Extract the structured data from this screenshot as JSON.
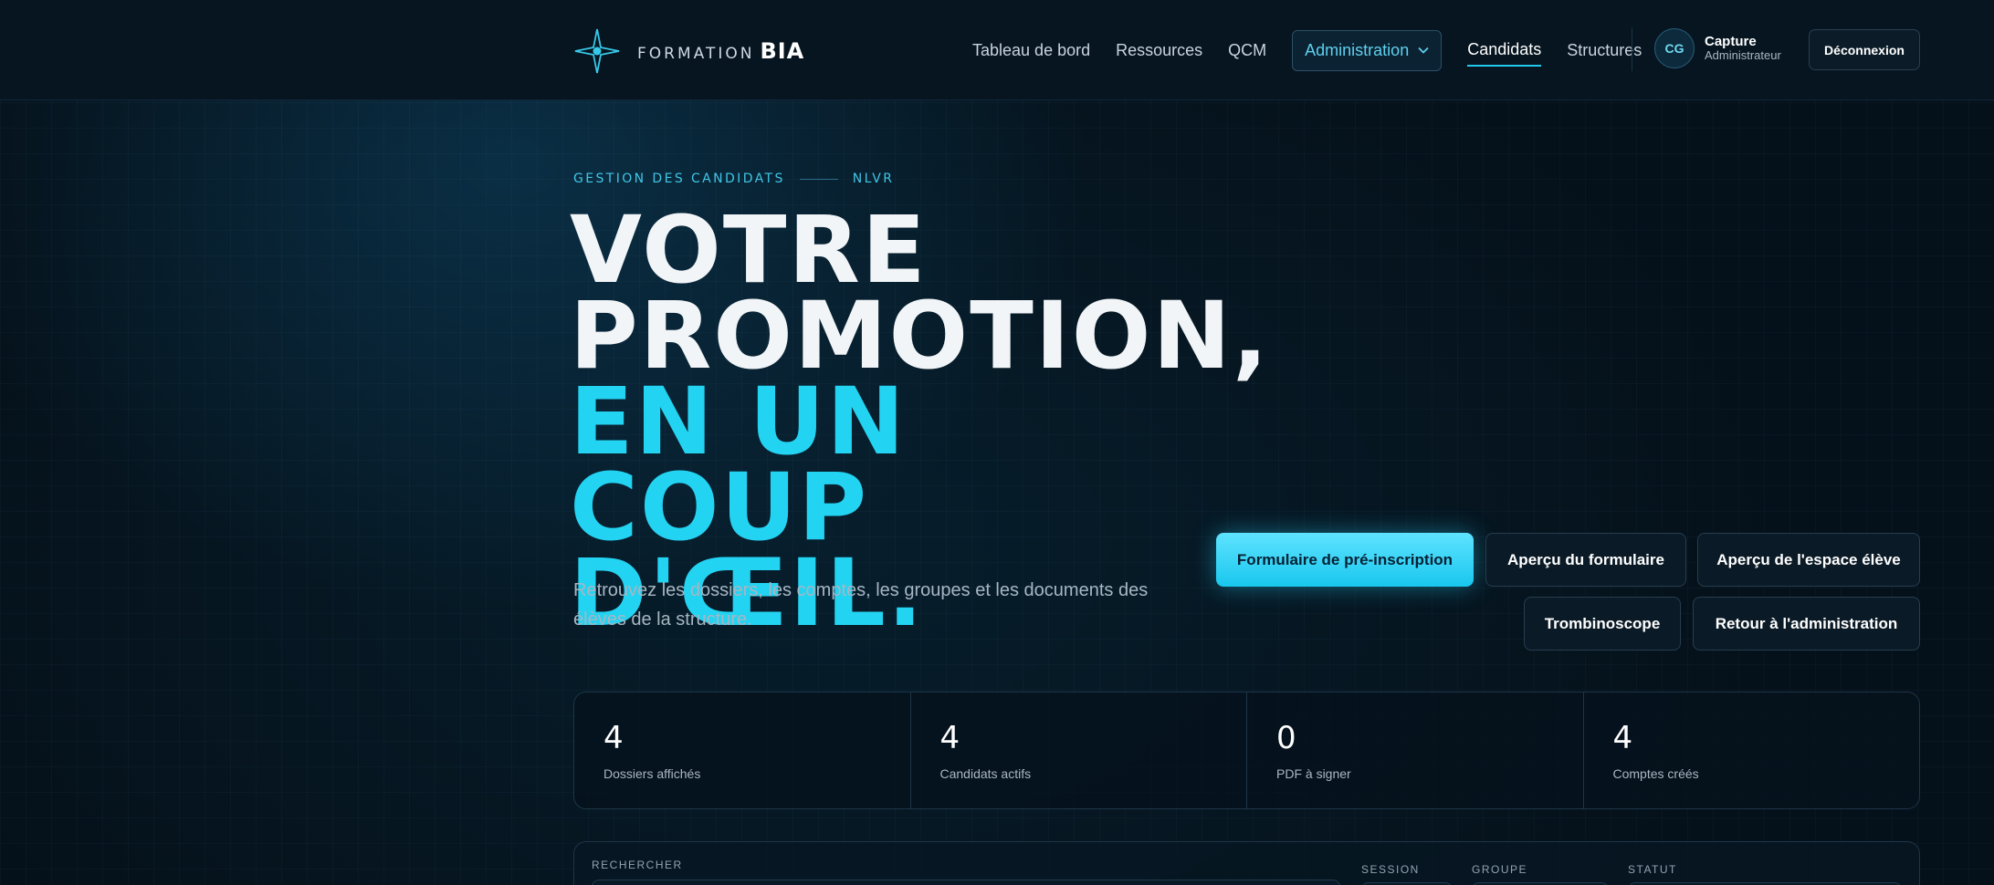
{
  "colors": {
    "accent": "#23d3f2",
    "background": "#05111a",
    "panel_border": "#1e3547"
  },
  "brand": {
    "prefix": "FORMATION",
    "name": "BIA",
    "icon": "compass-star-icon"
  },
  "nav": {
    "items": [
      "Tableau de bord",
      "Ressources",
      "QCM"
    ],
    "dropdown_label": "Administration",
    "active_label": "Candidats",
    "last_label": "Structures"
  },
  "user": {
    "initials": "CG",
    "name": "Capture",
    "role": "Administrateur"
  },
  "logout_label": "Déconnexion",
  "hero": {
    "eyebrow": "GESTION DES CANDIDATS",
    "eyebrow_code": "NLVR",
    "line1": "VOTRE",
    "line2": "PROMOTION,",
    "line3": "EN UN COUP",
    "line4": "D'ŒIL.",
    "lead": "Retrouvez les dossiers, les comptes, les groupes et les documents des élèves de la structure."
  },
  "actions": {
    "preregistration": "Formulaire de pré-inscription",
    "form_preview": "Aperçu du formulaire",
    "student_space_preview": "Aperçu de l'espace élève",
    "yearbook": "Trombinoscope",
    "back_admin": "Retour à l'administration"
  },
  "stats": [
    {
      "value": "4",
      "label": "Dossiers affichés"
    },
    {
      "value": "4",
      "label": "Candidats actifs"
    },
    {
      "value": "0",
      "label": "PDF à signer"
    },
    {
      "value": "4",
      "label": "Comptes créés"
    }
  ],
  "filters": {
    "search_label": "RECHERCHER",
    "session_label": "SESSION",
    "group_label": "GROUPE",
    "status_label": "STATUT"
  }
}
